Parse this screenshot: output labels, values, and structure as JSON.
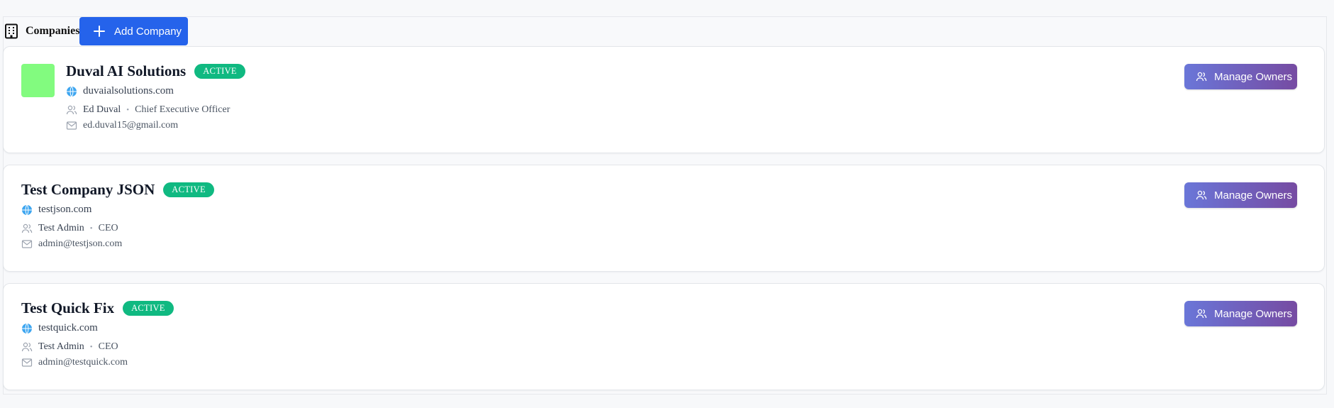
{
  "header": {
    "title": "Companies",
    "add_button_label": "Add Company"
  },
  "colors": {
    "primary": "#2563eb",
    "active_badge": "#10b981",
    "manage_gradient_start": "#6a76d8",
    "manage_gradient_end": "#764ba2",
    "logo_green": "#82fb7f"
  },
  "companies": [
    {
      "name": "Duval AI Solutions",
      "status": "ACTIVE",
      "domain": "duvaialsolutions.com",
      "owner_name": "Ed Duval",
      "owner_role": "Chief Executive Officer",
      "owner_email": "ed.duval15@gmail.com",
      "manage_label": "Manage Owners"
    },
    {
      "name": "Test Company JSON",
      "status": "ACTIVE",
      "domain": "testjson.com",
      "owner_name": "Test Admin",
      "owner_role": "CEO",
      "owner_email": "admin@testjson.com",
      "manage_label": "Manage Owners"
    },
    {
      "name": "Test Quick Fix",
      "status": "ACTIVE",
      "domain": "testquick.com",
      "owner_name": "Test Admin",
      "owner_role": "CEO",
      "owner_email": "admin@testquick.com",
      "manage_label": "Manage Owners"
    }
  ]
}
